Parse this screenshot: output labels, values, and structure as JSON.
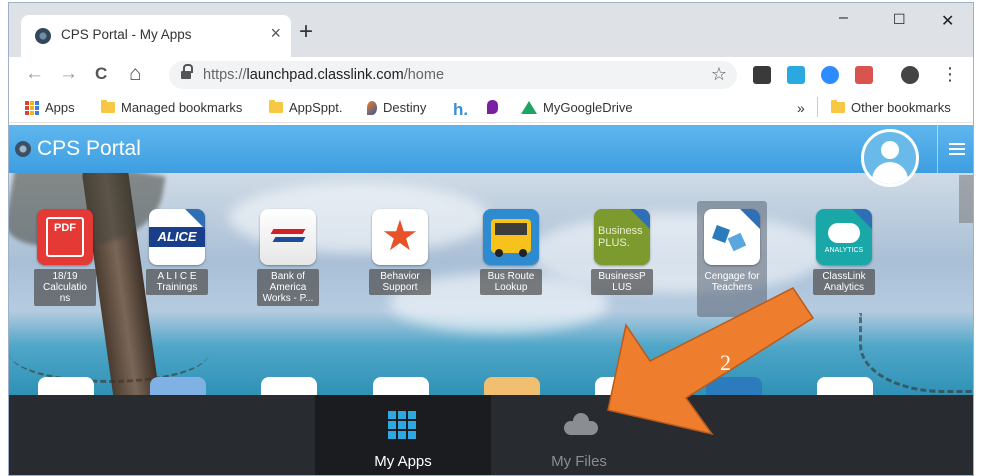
{
  "browser": {
    "tab_title": "CPS Portal - My Apps",
    "tab_close": "×",
    "new_tab": "+",
    "window_controls": {
      "minimize": "–",
      "maximize": "☐",
      "close": "✕"
    },
    "nav": {
      "back": "←",
      "forward": "→",
      "reload": "C",
      "home": "⌂"
    },
    "url_scheme": "https://",
    "url_host": "launchpad.classlink.com",
    "url_path": "/home",
    "bookmark_star": "☆",
    "menu": "⋮"
  },
  "bookmarks": {
    "items": [
      {
        "label": "Apps",
        "icon": "apps-grid-icon"
      },
      {
        "label": "Managed bookmarks",
        "icon": "folder-icon"
      },
      {
        "label": "AppSppt.",
        "icon": "folder-icon"
      },
      {
        "label": "Destiny",
        "icon": "destiny-icon"
      },
      {
        "label": "",
        "icon": "h-icon"
      },
      {
        "label": "",
        "icon": "p-icon"
      },
      {
        "label": "MyGoogleDrive",
        "icon": "google-drive-icon"
      }
    ],
    "overflow": "»",
    "other": "Other bookmarks"
  },
  "portal": {
    "title": "CPS Portal"
  },
  "apps": [
    {
      "label": "18/19 Calculatio ns",
      "icon": "pdf-icon",
      "color": "#e53935"
    },
    {
      "label": "A L I C E Trainings",
      "icon": "alice-icon",
      "color": "#ffffff"
    },
    {
      "label": "Bank of America Works - P...",
      "icon": "bank-of-america-icon",
      "color": "#ffffff"
    },
    {
      "label": "Behavior Support",
      "icon": "star-icon",
      "color": "#ffffff"
    },
    {
      "label": "Bus Route Lookup",
      "icon": "school-bus-icon",
      "color": "#2f8bd0"
    },
    {
      "label": "BusinessP LUS",
      "icon": "businessplus-icon",
      "color": "#7c9a2e"
    },
    {
      "label": "Cengage for Teachers",
      "icon": "cengage-icon",
      "color": "#2b7bbd"
    },
    {
      "label": "ClassLink Analytics",
      "icon": "analytics-cloud-icon",
      "color": "#1aa7a7"
    }
  ],
  "bottom_nav": {
    "my_apps": "My Apps",
    "my_files": "My Files"
  },
  "annotation": {
    "number": "2",
    "color": "#ee7d2e"
  }
}
